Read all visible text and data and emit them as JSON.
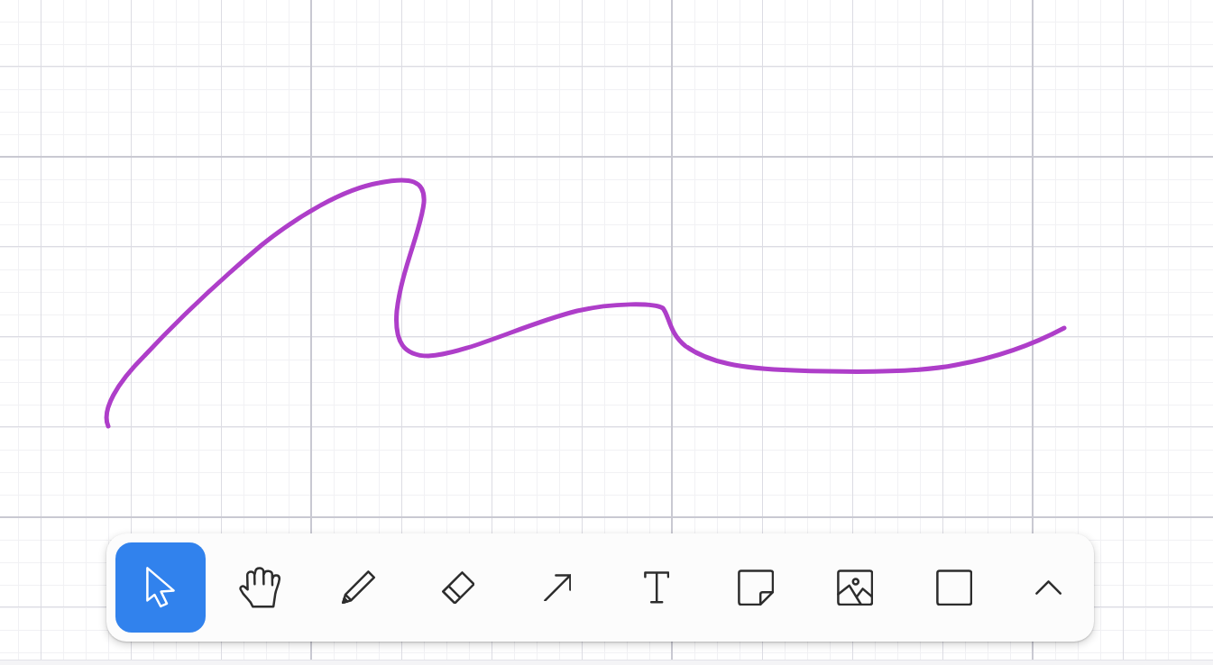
{
  "canvas": {
    "shapes": [
      {
        "kind": "freehand"
      }
    ]
  },
  "toolbar": {
    "tools": [
      {
        "kind": "select",
        "selected": true
      },
      {
        "kind": "hand",
        "selected": false
      },
      {
        "kind": "draw",
        "selected": false
      },
      {
        "kind": "eraser",
        "selected": false
      },
      {
        "kind": "arrow",
        "selected": false
      },
      {
        "kind": "text",
        "selected": false
      },
      {
        "kind": "note",
        "selected": false
      },
      {
        "kind": "image",
        "selected": false
      },
      {
        "kind": "rectangle",
        "selected": false
      },
      {
        "kind": "more",
        "selected": false
      }
    ]
  }
}
